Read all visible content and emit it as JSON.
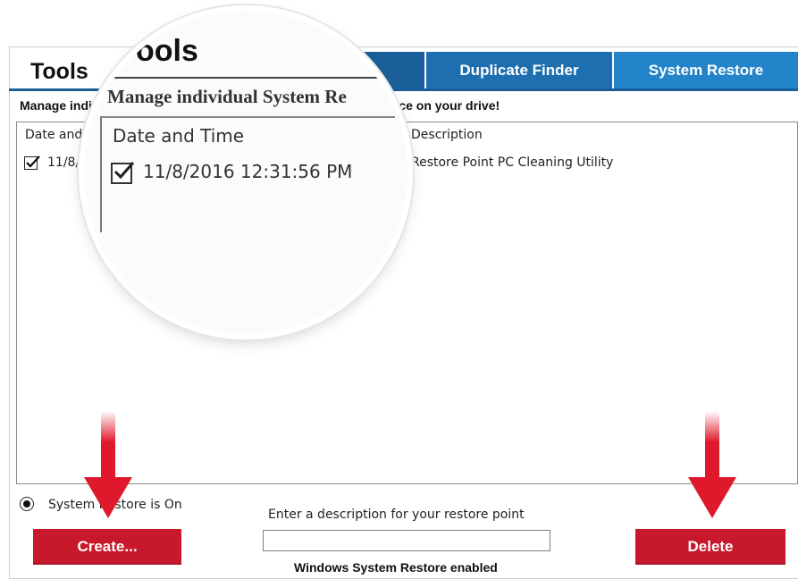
{
  "header": {
    "title": "Tools",
    "tabs": [
      {
        "label": ""
      },
      {
        "label": "Duplicate Finder"
      },
      {
        "label": "System Restore"
      }
    ],
    "manage_text": "Manage individual System Restore points to free up space on your drive!"
  },
  "table": {
    "columns": [
      "Date and Time",
      "Description"
    ],
    "rows": [
      {
        "checked": true,
        "date_time": "11/8/2016 12:31:56 PM",
        "description": "Restore Point PC Cleaning Utility"
      }
    ]
  },
  "visible": {
    "manage_left": "Manage indi",
    "manage_right": "pace on your drive!",
    "col1_partial": "Date and",
    "row_date_partial": "11/8/"
  },
  "magnifier": {
    "title": "Tools",
    "title_partial": "ools",
    "manage_partial": "Manage individual System Re",
    "header": "Date and Time",
    "row": "11/8/2016 12:31:56 PM"
  },
  "footer": {
    "radio_label": "System Restore is On",
    "description_label": "Enter a description for your restore point",
    "description_value": "",
    "status": "Windows System Restore enabled",
    "create_label": "Create...",
    "delete_label": "Delete"
  },
  "colors": {
    "tab_blue": "#1d6fb0",
    "tab_active": "#2484c9",
    "button_red": "#c8182b",
    "arrow_red": "#e0182b"
  }
}
